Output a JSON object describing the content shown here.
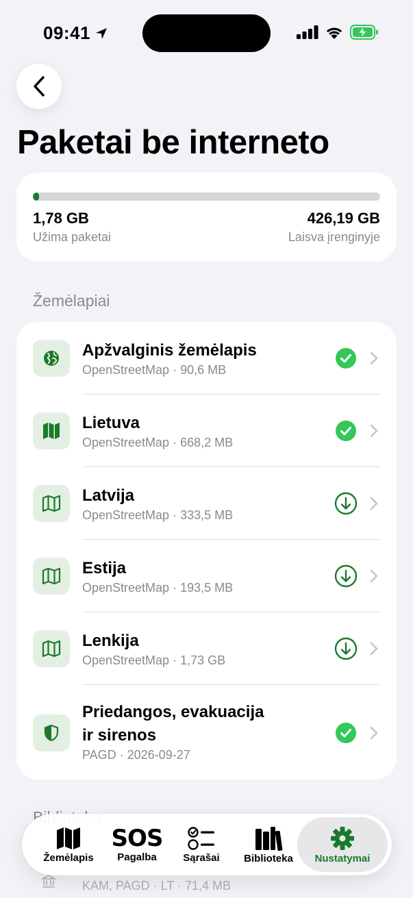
{
  "status_bar": {
    "time": "09:41"
  },
  "page": {
    "title": "Paketai be interneto"
  },
  "storage": {
    "used_value": "1,78 GB",
    "used_label": "Užima paketai",
    "free_value": "426,19 GB",
    "free_label": "Laisva įrenginyje",
    "used_fraction": 0.004
  },
  "maps_section": {
    "header": "Žemėlapiai",
    "items": [
      {
        "title": "Apžvalginis žemėlapis",
        "subtitle": "OpenStreetMap · 90,6 MB",
        "icon": "globe-icon",
        "status": "downloaded"
      },
      {
        "title": "Lietuva",
        "subtitle": "OpenStreetMap · 668,2 MB",
        "icon": "map-filled-icon",
        "status": "downloaded"
      },
      {
        "title": "Latvija",
        "subtitle": "OpenStreetMap · 333,5 MB",
        "icon": "map-outline-icon",
        "status": "download"
      },
      {
        "title": "Estija",
        "subtitle": "OpenStreetMap · 193,5 MB",
        "icon": "map-outline-icon",
        "status": "download"
      },
      {
        "title": "Lenkija",
        "subtitle": "OpenStreetMap · 1,73 GB",
        "icon": "map-outline-icon",
        "status": "download"
      },
      {
        "title_line1": "Priedangos, evakuacija",
        "title_line2": "ir sirenos",
        "subtitle": "PAGD · 2026-09-27",
        "icon": "shield-icon",
        "status": "downloaded"
      }
    ]
  },
  "next_section": {
    "header": "Biblioteka",
    "peek_item_subtitle": "KAM, PAGD · LT · 71,4 MB"
  },
  "tabbar": {
    "tabs": [
      {
        "label": "Žemėlapis",
        "icon": "map-icon"
      },
      {
        "label": "Pagalba",
        "icon": "sos-icon",
        "glyph": "SOS"
      },
      {
        "label": "Sąrašai",
        "icon": "checklist-icon"
      },
      {
        "label": "Biblioteka",
        "icon": "books-icon"
      },
      {
        "label": "Nustatymai",
        "icon": "gear-icon",
        "active": true
      }
    ]
  },
  "colors": {
    "accent": "#1b7a2a",
    "check": "#34c759",
    "icon_bg": "#e3efe3",
    "background": "#f2f2f7"
  }
}
